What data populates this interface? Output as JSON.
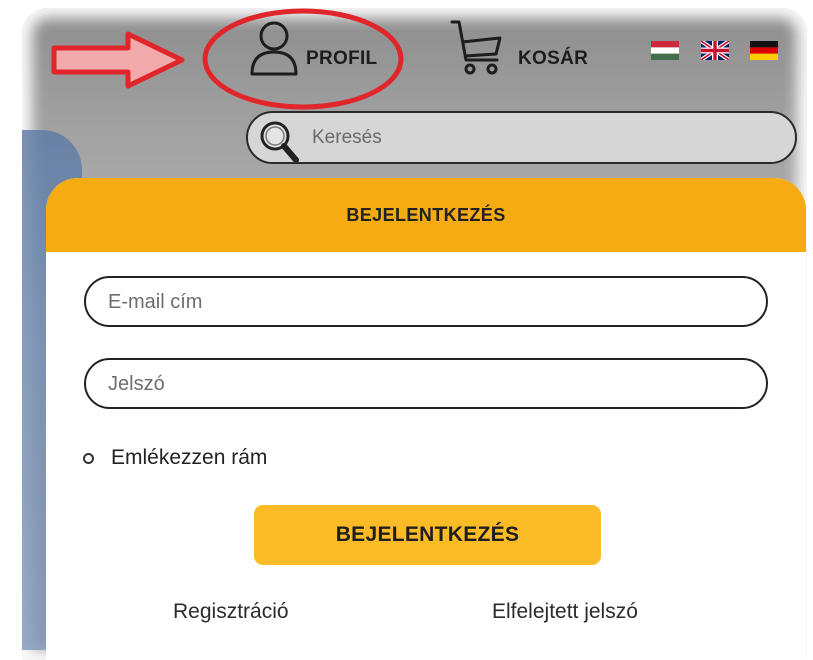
{
  "header": {
    "profile_label": "PROFIL",
    "cart_label": "KOSÁR",
    "languages": [
      "hungarian-flag",
      "english-flag",
      "german-flag"
    ]
  },
  "search": {
    "placeholder": "Keresés"
  },
  "login": {
    "title": "BEJELENTKEZÉS",
    "email_placeholder": "E-mail cím",
    "password_placeholder": "Jelszó",
    "remember_label": "Emlékezzen rám",
    "submit_label": "BEJELENTKEZÉS",
    "register_link": "Regisztráció",
    "forgot_link": "Elfelejtett jelszó"
  },
  "colors": {
    "accent_orange": "#f5ab12",
    "button_yellow": "#fbbb27",
    "annotation_red": "#e0262b"
  }
}
